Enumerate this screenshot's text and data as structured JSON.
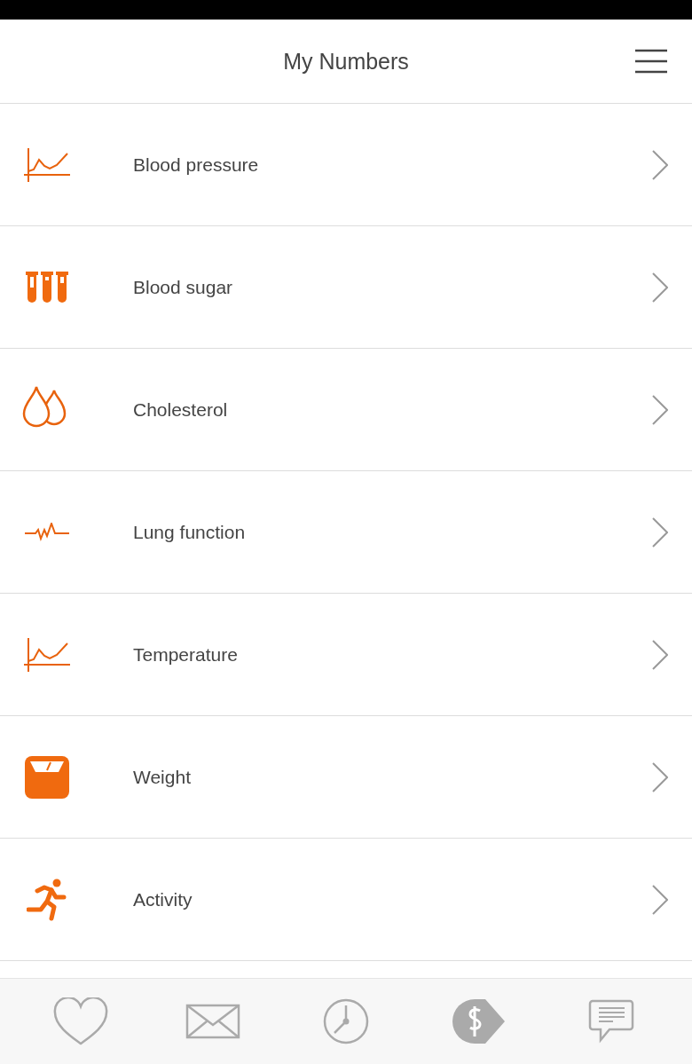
{
  "header": {
    "title": "My Numbers"
  },
  "items": [
    {
      "label": "Blood pressure",
      "kind": "chart"
    },
    {
      "label": "Blood sugar",
      "kind": "tubes"
    },
    {
      "label": "Cholesterol",
      "kind": "drops"
    },
    {
      "label": "Lung function",
      "kind": "pulse"
    },
    {
      "label": "Temperature",
      "kind": "chart"
    },
    {
      "label": "Weight",
      "kind": "scale"
    },
    {
      "label": "Activity",
      "kind": "runner"
    }
  ],
  "nav": [
    {
      "kind": "heart"
    },
    {
      "kind": "mail"
    },
    {
      "kind": "clock"
    },
    {
      "kind": "price"
    },
    {
      "kind": "chat"
    }
  ]
}
